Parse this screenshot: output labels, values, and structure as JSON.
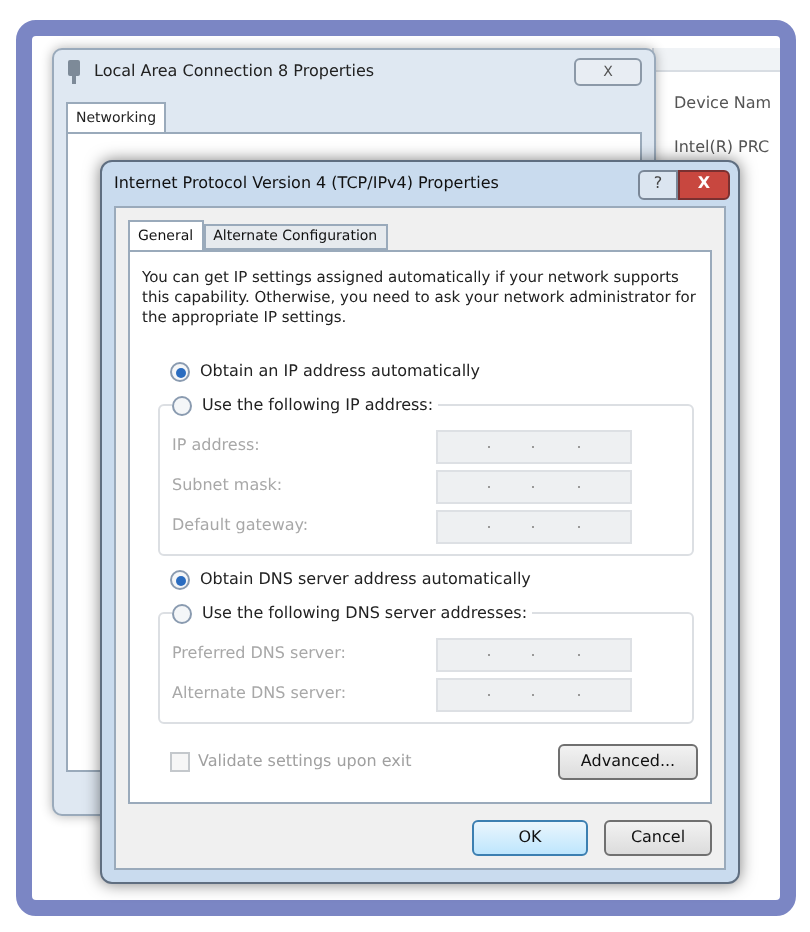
{
  "back_window": {
    "title": "Local Area Connection 8 Properties",
    "close": "X",
    "tabs": [
      {
        "label": "Networking",
        "selected": true
      }
    ]
  },
  "side_window": {
    "lines": [
      "Device Nam",
      "Intel(R) PRC"
    ]
  },
  "dialog": {
    "title": "Internet Protocol Version 4 (TCP/IPv4) Properties",
    "help": "?",
    "close": "X",
    "tabs": [
      {
        "label": "General",
        "selected": true
      },
      {
        "label": "Alternate Configuration",
        "selected": false
      }
    ],
    "intro": "You can get IP settings assigned automatically if your network supports this capability. Otherwise, you need to ask your network administrator for the appropriate IP settings.",
    "ip_options": [
      {
        "label": "Obtain an IP address automatically",
        "selected": true
      },
      {
        "label": "Use the following IP address:",
        "selected": false
      }
    ],
    "ip_fields": [
      {
        "label": "IP address:",
        "disabled": true
      },
      {
        "label": "Subnet mask:",
        "disabled": true
      },
      {
        "label": "Default gateway:",
        "disabled": true
      }
    ],
    "dns_options": [
      {
        "label": "Obtain DNS server address automatically",
        "selected": true
      },
      {
        "label": "Use the following DNS server addresses:",
        "selected": false
      }
    ],
    "dns_fields": [
      {
        "label": "Preferred DNS server:",
        "disabled": true
      },
      {
        "label": "Alternate DNS server:",
        "disabled": true
      }
    ],
    "validate": {
      "label": "Validate settings upon exit",
      "checked": false,
      "disabled": true
    },
    "advanced_button": "Advanced...",
    "buttons": [
      {
        "label": "OK",
        "kind": "default"
      },
      {
        "label": "Cancel",
        "kind": "normal"
      }
    ]
  }
}
